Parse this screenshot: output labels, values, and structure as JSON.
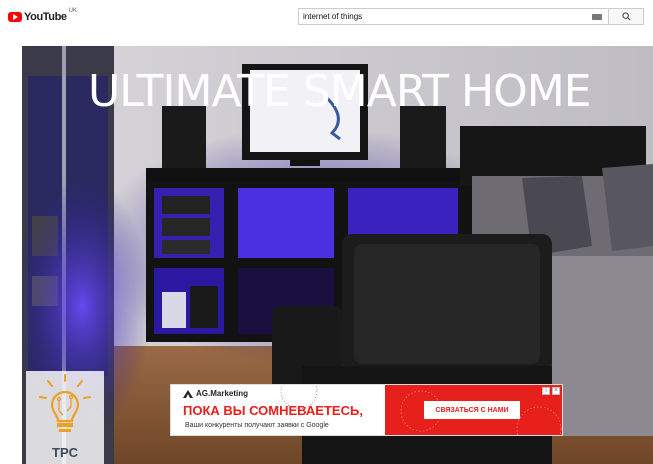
{
  "header": {
    "logo_text": "YouTube",
    "logo_region": "UK",
    "search": {
      "value": "internet of things",
      "placeholder": "Search"
    }
  },
  "video": {
    "title_overlay": "ULTIMATE SMART HOME"
  },
  "channel_watermark": {
    "label": "TPC"
  },
  "ad": {
    "brand": "AG.Marketing",
    "headline": "ПОКА ВЫ СОМНЕВАЕТЕСЬ,",
    "subtext": "Ваши конкуренты получают заявки с Google",
    "cta_label": "СВЯЗАТЬСЯ С НАМИ",
    "info_icon": "info-icon",
    "close_icon": "close-icon",
    "colors": {
      "accent": "#e8201b"
    }
  },
  "colors": {
    "brand_red": "#ff0000",
    "led_purple": "#5a3dff"
  }
}
